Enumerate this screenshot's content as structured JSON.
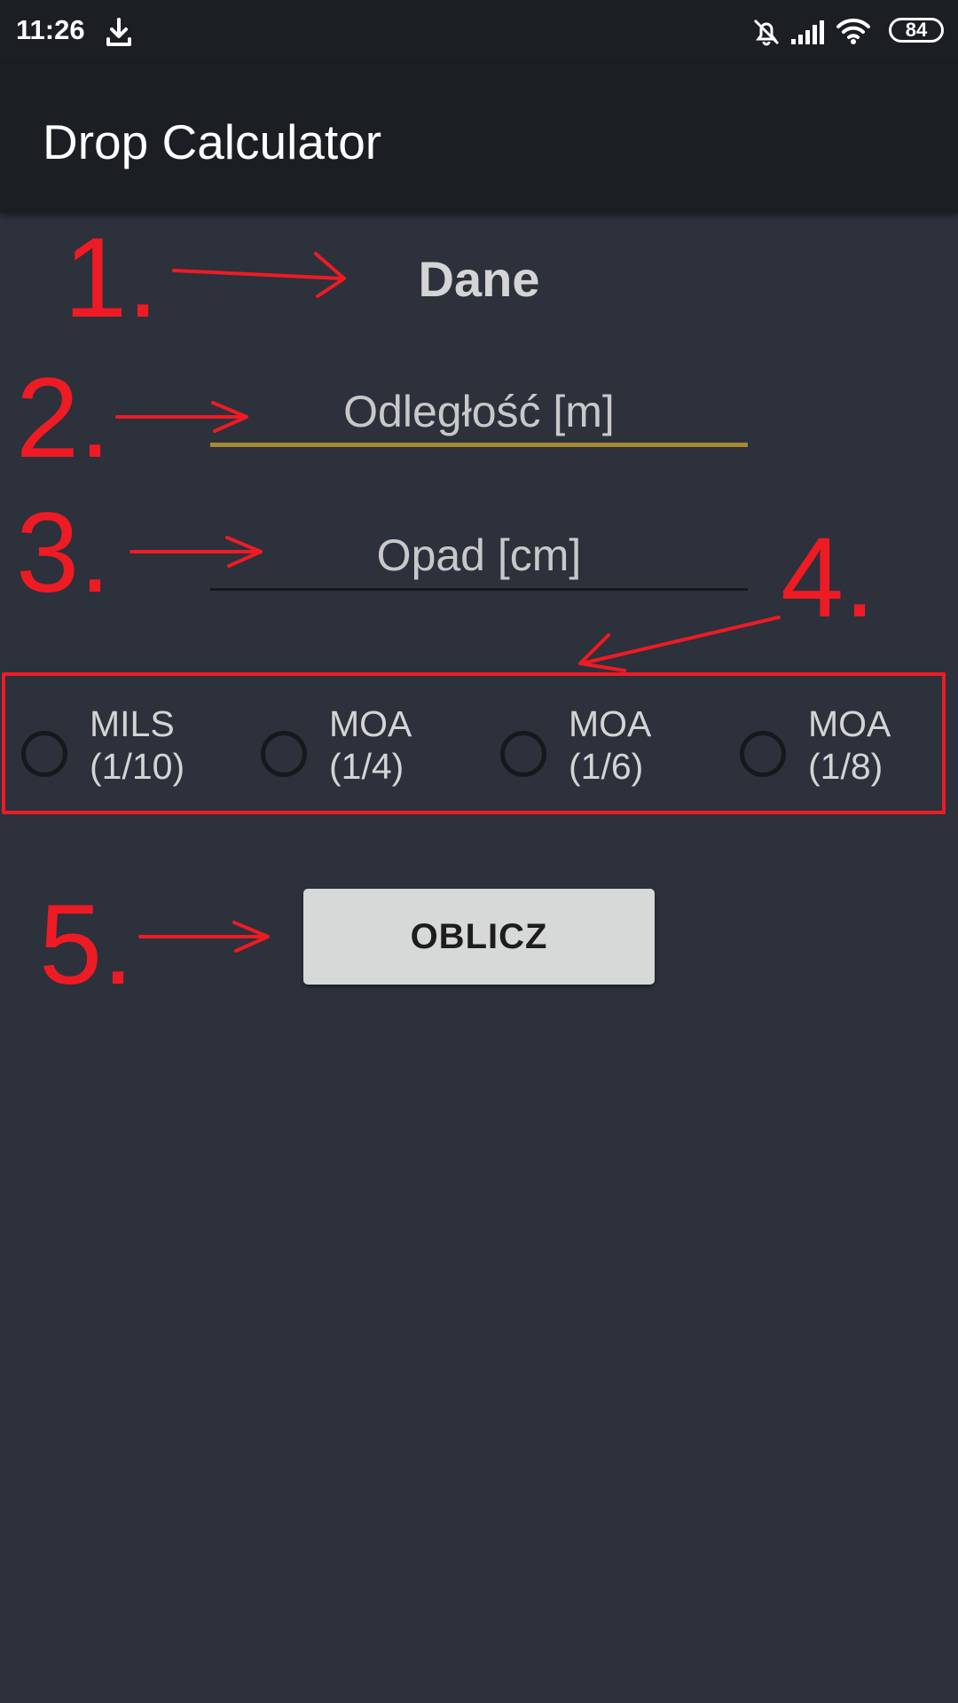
{
  "status_bar": {
    "time": "11:26",
    "battery": "84",
    "icons": [
      "download-icon",
      "bell-off-icon",
      "signal-icon",
      "wifi-icon",
      "battery-icon"
    ]
  },
  "app_bar": {
    "title": "Drop Calculator"
  },
  "form": {
    "section_title": "Dane",
    "distance": {
      "placeholder": "Odległość [m]",
      "value": ""
    },
    "drop": {
      "placeholder": "Opad [cm]",
      "value": ""
    },
    "units": [
      {
        "line1": "MILS",
        "line2": "(1/10)",
        "checked": false
      },
      {
        "line1": "MOA",
        "line2": "(1/4)",
        "checked": false
      },
      {
        "line1": "MOA",
        "line2": "(1/6)",
        "checked": false
      },
      {
        "line1": "MOA",
        "line2": "(1/8)",
        "checked": false
      }
    ],
    "calculate_button": "OBLICZ"
  },
  "annotations": {
    "marks": [
      "1.",
      "2.",
      "3.",
      "4.",
      "5."
    ],
    "color": "#ee1b24"
  },
  "colors": {
    "background": "#2c313c",
    "app_bar": "#1b1e23",
    "accent_underline": "#a58a2f",
    "button": "#d7d8d8"
  }
}
